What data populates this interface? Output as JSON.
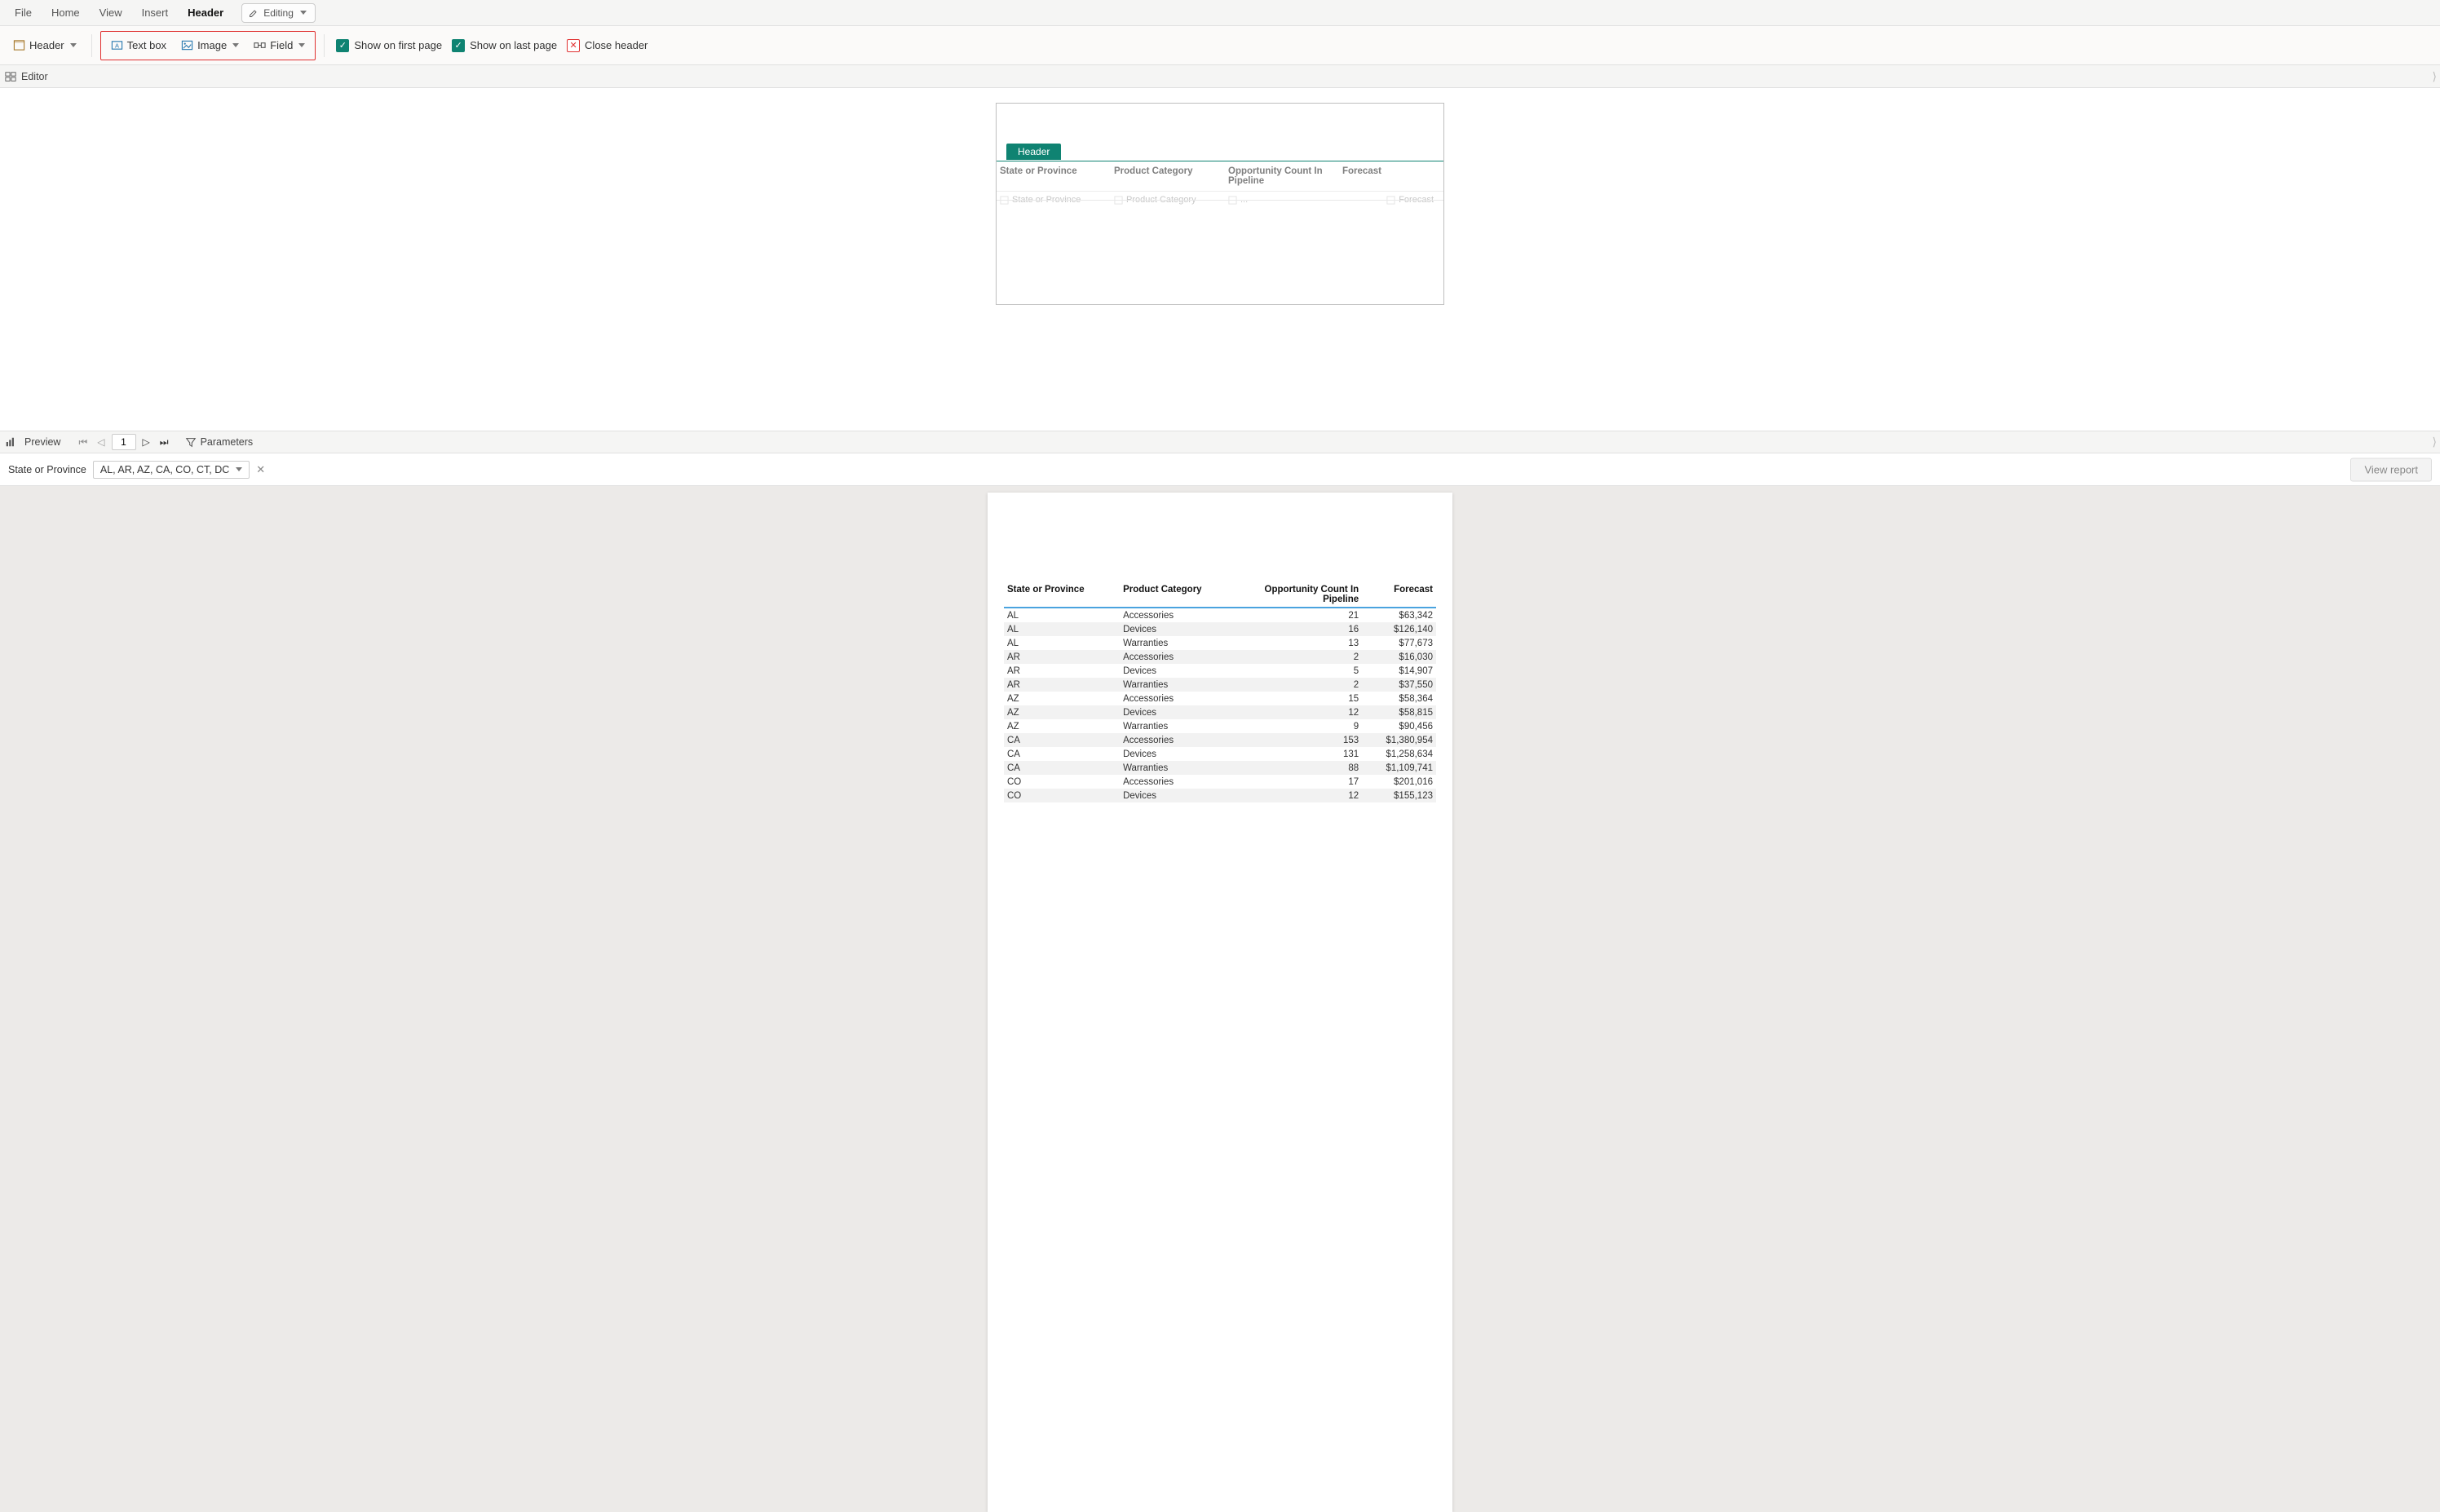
{
  "menu": {
    "tabs": [
      "File",
      "Home",
      "View",
      "Insert",
      "Header"
    ],
    "active": "Header",
    "mode_label": "Editing"
  },
  "ribbon": {
    "header_btn": "Header",
    "textbox_btn": "Text box",
    "image_btn": "Image",
    "field_btn": "Field",
    "show_first": "Show on first page",
    "show_last": "Show on last page",
    "close_header": "Close header"
  },
  "editor": {
    "title": "Editor",
    "header_tab": "Header",
    "columns": [
      {
        "label": "State or Province",
        "placeholder": "State or Province",
        "align": "left"
      },
      {
        "label": "Product Category",
        "placeholder": "Product Category",
        "align": "left"
      },
      {
        "label": "Opportunity Count In Pipeline",
        "placeholder": "...",
        "align": "left"
      },
      {
        "label": "Forecast",
        "placeholder": "Forecast",
        "align": "right"
      }
    ]
  },
  "preview": {
    "title": "Preview",
    "page": "1",
    "parameters": "Parameters"
  },
  "filter": {
    "label": "State or Province",
    "value": "AL, AR, AZ, CA, CO, CT, DC",
    "view_report": "View report"
  },
  "report": {
    "headers": [
      "State or Province",
      "Product Category",
      "Opportunity Count In Pipeline",
      "Forecast"
    ],
    "rows": [
      {
        "state": "AL",
        "cat": "Accessories",
        "count": "21",
        "forecast": "$63,342"
      },
      {
        "state": "AL",
        "cat": "Devices",
        "count": "16",
        "forecast": "$126,140"
      },
      {
        "state": "AL",
        "cat": "Warranties",
        "count": "13",
        "forecast": "$77,673"
      },
      {
        "state": "AR",
        "cat": "Accessories",
        "count": "2",
        "forecast": "$16,030"
      },
      {
        "state": "AR",
        "cat": "Devices",
        "count": "5",
        "forecast": "$14,907"
      },
      {
        "state": "AR",
        "cat": "Warranties",
        "count": "2",
        "forecast": "$37,550"
      },
      {
        "state": "AZ",
        "cat": "Accessories",
        "count": "15",
        "forecast": "$58,364"
      },
      {
        "state": "AZ",
        "cat": "Devices",
        "count": "12",
        "forecast": "$58,815"
      },
      {
        "state": "AZ",
        "cat": "Warranties",
        "count": "9",
        "forecast": "$90,456"
      },
      {
        "state": "CA",
        "cat": "Accessories",
        "count": "153",
        "forecast": "$1,380,954"
      },
      {
        "state": "CA",
        "cat": "Devices",
        "count": "131",
        "forecast": "$1,258,634"
      },
      {
        "state": "CA",
        "cat": "Warranties",
        "count": "88",
        "forecast": "$1,109,741"
      },
      {
        "state": "CO",
        "cat": "Accessories",
        "count": "17",
        "forecast": "$201,016"
      },
      {
        "state": "CO",
        "cat": "Devices",
        "count": "12",
        "forecast": "$155,123"
      }
    ]
  }
}
